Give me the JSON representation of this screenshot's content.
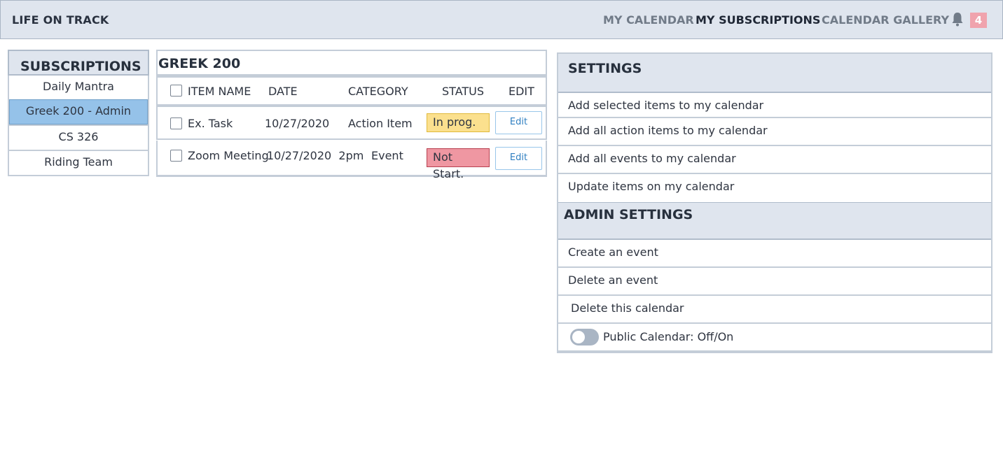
{
  "app": {
    "title": "LIFE ON TRACK"
  },
  "nav": {
    "my_calendar": "MY CALENDAR",
    "my_subscriptions": "MY SUBSCRIPTIONS",
    "calendar_gallery": "CALENDAR GALLERY",
    "notification_count": "4"
  },
  "subscriptions": {
    "title": "SUBSCRIPTIONS",
    "items": [
      {
        "label": "Daily Mantra",
        "selected": false
      },
      {
        "label": "Greek 200 - Admin",
        "selected": true
      },
      {
        "label": "CS 326",
        "selected": false
      },
      {
        "label": "Riding Team",
        "selected": false
      }
    ]
  },
  "calendar": {
    "title": "GREEK 200",
    "columns": [
      "ITEM NAME",
      "DATE",
      "CATEGORY",
      "STATUS",
      "EDIT"
    ],
    "rows": [
      {
        "name": "Ex. Task",
        "date": "10/27/2020",
        "category": "Action Item",
        "status": "In prog.",
        "edit": "Edit"
      },
      {
        "name": "Zoom Meeting",
        "date": "10/27/2020  2pm",
        "category": "Event",
        "status": "Not Start.",
        "edit": "Edit"
      }
    ]
  },
  "settings": {
    "title": "SETTINGS",
    "items": [
      "Add selected items to my calendar",
      "Add all action items to my calendar",
      "Add all events to my calendar",
      "Update items on my calendar"
    ],
    "admin_title": "ADMIN SETTINGS",
    "admin_items": [
      "Create an event",
      "Delete an event",
      "Delete this calendar"
    ],
    "public_toggle_label": "Public Calendar: Off/On",
    "public_toggle_on": false
  },
  "colors": {
    "header_bg": "#dfe5ee",
    "selected_bg": "#95c2e9",
    "status_in_progress": "#fbe08e",
    "status_not_started": "#ef97a2",
    "badge": "#f0a3ad"
  },
  "icons": {
    "notifications": "bell-icon"
  }
}
